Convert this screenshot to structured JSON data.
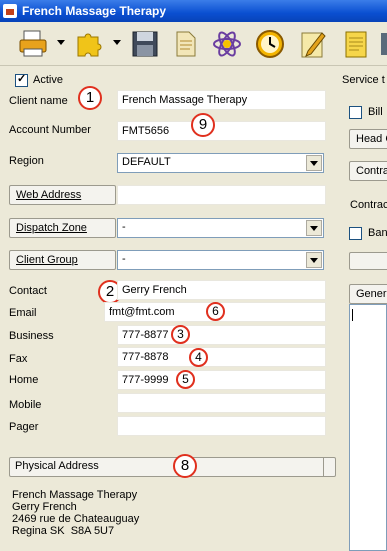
{
  "window": {
    "title": "French Massage Therapy"
  },
  "toolbar": {
    "icons": [
      "printer-icon",
      "puzzle-icon",
      "save-disk-icon",
      "document-icon",
      "atom-icon",
      "clock-icon",
      "pencil-paper-icon",
      "notepad-icon",
      "app-icon"
    ]
  },
  "form": {
    "active_label": "Active",
    "client_name_label": "Client name",
    "client_name_value": "French Massage Therapy",
    "account_number_label": "Account Number",
    "account_number_value": "FMT5656",
    "region_label": "Region",
    "region_value": "DEFAULT",
    "web_address_button": "Web Address",
    "web_address_value": "",
    "dispatch_zone_button": "Dispatch Zone",
    "dispatch_zone_value": "-",
    "client_group_button": "Client Group",
    "client_group_value": "-",
    "contact_label": "Contact",
    "contact_value": "Gerry French",
    "email_label": "Email",
    "email_value": "fmt@fmt.com",
    "business_label": "Business",
    "business_value": "777-8877",
    "fax_label": "Fax",
    "fax_value": "777-8878",
    "home_label": "Home",
    "home_value": "777-9999",
    "mobile_label": "Mobile",
    "mobile_value": "",
    "pager_label": "Pager",
    "pager_value": "",
    "address_button": "Physical Address",
    "address_lines": [
      "French Massage Therapy",
      "Gerry French",
      "2469 rue de Chateauguay",
      "Regina SK  S8A 5U7"
    ]
  },
  "annotations": [
    "1",
    "9",
    "2",
    "6",
    "3",
    "4",
    "5",
    "8"
  ],
  "right_panel": {
    "service_label": "Service t",
    "bill_label": "Bill",
    "head_button": "Head C",
    "contra_button": "Contra",
    "contract_label": "Contrac",
    "ban_label": "Ban",
    "gener_button": "Gener"
  }
}
